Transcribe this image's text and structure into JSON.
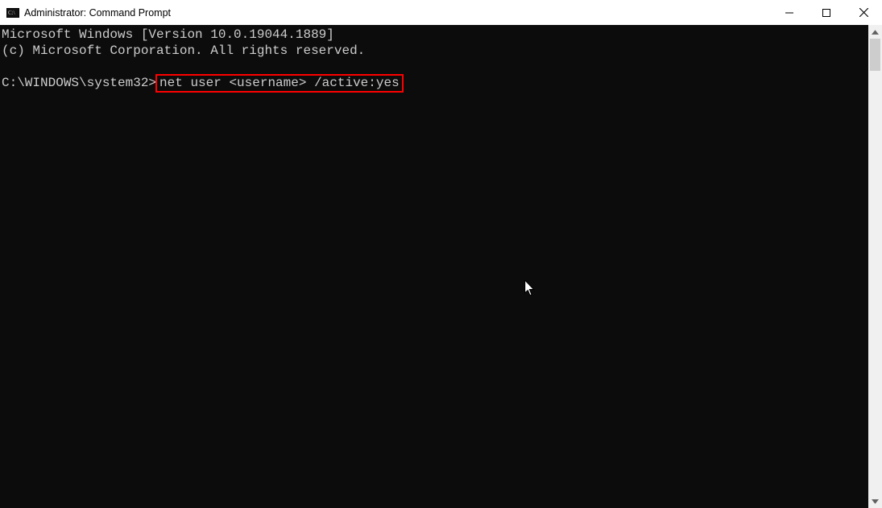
{
  "window": {
    "title": "Administrator: Command Prompt"
  },
  "terminal": {
    "line1": "Microsoft Windows [Version 10.0.19044.1889]",
    "line2": "(c) Microsoft Corporation. All rights reserved.",
    "blank": "",
    "prompt_prefix": "C:\\WINDOWS\\system32>",
    "command": "net user <username> /active:yes"
  }
}
